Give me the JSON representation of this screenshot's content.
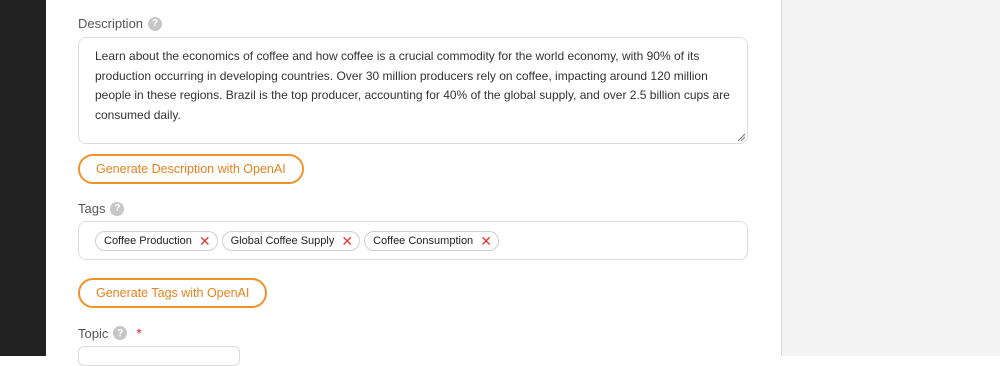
{
  "description": {
    "label": "Description",
    "help_icon": "?",
    "value": "Learn about the economics of coffee and how coffee is a crucial commodity for the world economy, with 90% of its production occurring in developing countries. Over 30 million producers rely on coffee, impacting around 120 million people in these regions. Brazil is the top producer, accounting for 40% of the global supply, and over 2.5 billion cups are consumed daily.",
    "generate_button": "Generate Description with OpenAI"
  },
  "tags": {
    "label": "Tags",
    "help_icon": "?",
    "items": [
      {
        "label": "Coffee Production",
        "remove": "✕"
      },
      {
        "label": "Global Coffee Supply",
        "remove": "✕"
      },
      {
        "label": "Coffee Consumption",
        "remove": "✕"
      }
    ],
    "generate_button": "Generate Tags with OpenAI"
  },
  "topic": {
    "label": "Topic",
    "help_icon": "?",
    "required_mark": "*"
  },
  "colors": {
    "accent": "#f0922a",
    "required": "#e02b2b",
    "tag_remove": "#e53935",
    "sidebar": "#222222"
  },
  "icons": {
    "help": "question-circle-icon",
    "remove": "x-icon",
    "resize": "resize-grip-icon"
  }
}
